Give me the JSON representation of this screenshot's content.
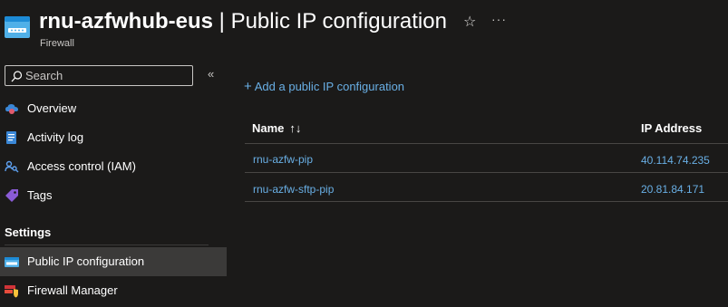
{
  "header": {
    "resource_name": "rnu-azfwhub-eus",
    "separator": " | ",
    "page_name": "Public IP configuration",
    "resource_type": "Firewall"
  },
  "search": {
    "placeholder": "Search"
  },
  "sidebar": {
    "items": [
      {
        "label": "Overview",
        "icon": "overview-icon"
      },
      {
        "label": "Activity log",
        "icon": "activity-log-icon"
      },
      {
        "label": "Access control (IAM)",
        "icon": "iam-icon"
      },
      {
        "label": "Tags",
        "icon": "tag-icon"
      }
    ],
    "section_title": "Settings",
    "settings_items": [
      {
        "label": "Public IP configuration",
        "icon": "public-ip-icon",
        "active": true
      },
      {
        "label": "Firewall Manager",
        "icon": "firewall-manager-icon",
        "active": false
      }
    ]
  },
  "toolbar": {
    "add_label": "Add a public IP configuration"
  },
  "table": {
    "columns": [
      "Name",
      "IP Address"
    ],
    "rows": [
      {
        "name": "rnu-azfw-pip",
        "ip": "40.114.74.235"
      },
      {
        "name": "rnu-azfw-sftp-pip",
        "ip": "20.81.84.171"
      }
    ]
  },
  "colors": {
    "background": "#1b1a19",
    "link": "#69afe5",
    "active_item": "#3b3a39",
    "accent": "#0078d4"
  }
}
